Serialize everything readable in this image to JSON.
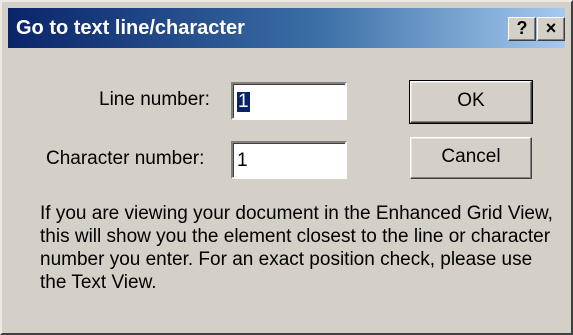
{
  "window": {
    "title": "Go to text line/character",
    "help_label": "?",
    "close_label": "×"
  },
  "form": {
    "line_label": "Line number:",
    "line_value": "1",
    "char_label": "Character number:",
    "char_value": "1"
  },
  "buttons": {
    "ok_label": "OK",
    "cancel_label": "Cancel"
  },
  "info_text": "If you are viewing your document in the Enhanced Grid View, this will show you the element closest to the line or character number you enter. For an exact position check, please use the Text View.",
  "colors": {
    "dialog_bg": "#d4d0c8",
    "titlebar_start": "#0a246a",
    "titlebar_end": "#a6caf0",
    "selection": "#0a246a"
  }
}
